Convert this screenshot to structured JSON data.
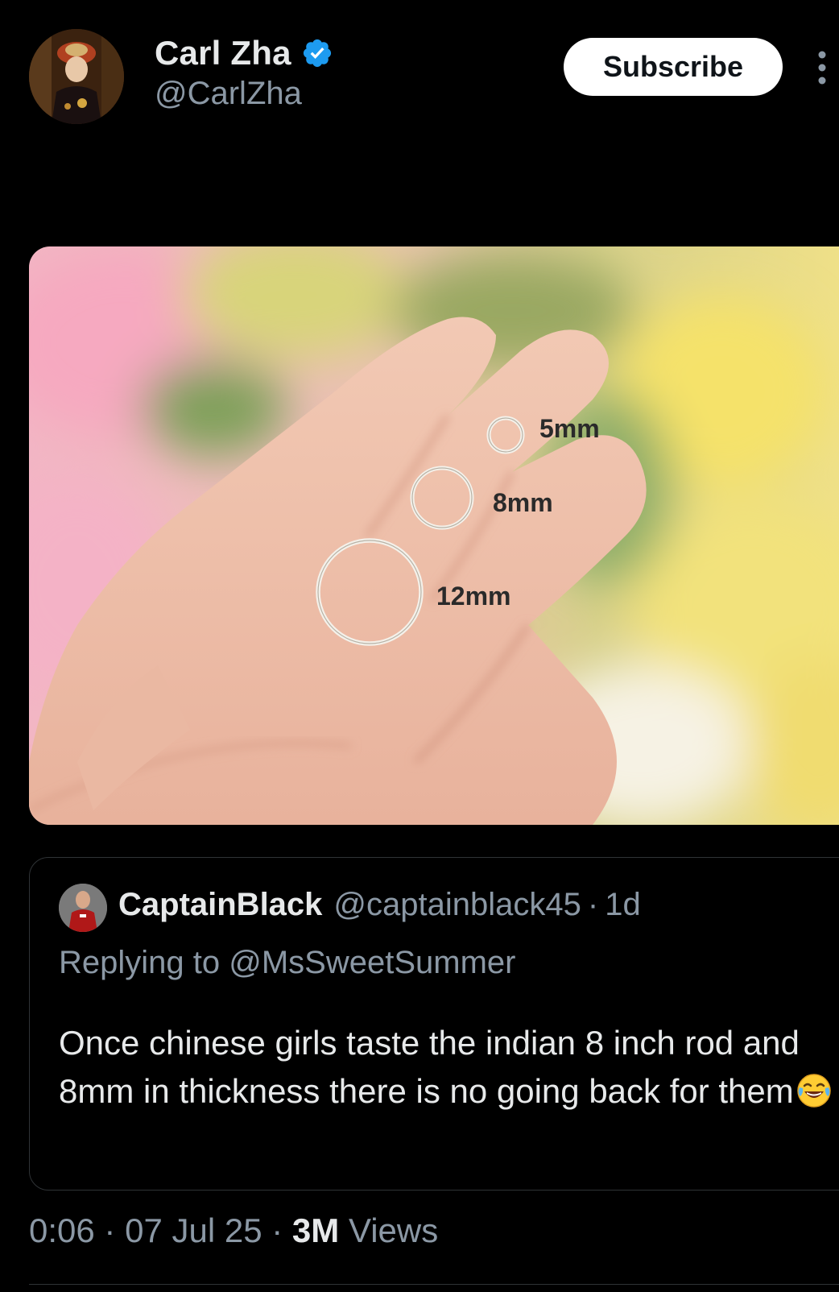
{
  "author": {
    "name": "Carl Zha",
    "handle": "@CarlZha",
    "verified_icon": "verified-badge",
    "verified_color": "#1d9bf0"
  },
  "header": {
    "subscribe_label": "Subscribe",
    "more_icon": "more-vertical"
  },
  "media": {
    "ring_labels": [
      "5mm",
      "8mm",
      "12mm"
    ]
  },
  "quote": {
    "name": "CaptainBlack",
    "handle": "@captainblack45",
    "separator": "·",
    "time": "1d",
    "replying_to": "Replying to @MsSweetSummer",
    "text": "Once chinese girls taste the indian 8 inch rod and 8mm in thickness there is no going back for them",
    "emoji": "face-with-tears-of-joy"
  },
  "meta": {
    "duration": "0:06",
    "date": "07 Jul 25",
    "views_count": "3M",
    "views_label": "Views",
    "separator": "·"
  },
  "colors": {
    "background": "#000000",
    "primary_text": "#e7e9ea",
    "secondary_text": "#8b98a5",
    "border": "#2f3336"
  }
}
